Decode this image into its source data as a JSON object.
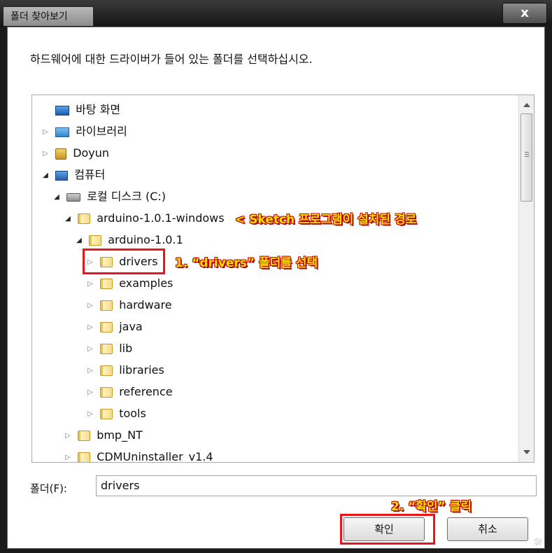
{
  "window": {
    "title": "폴더 찾아보기",
    "close_label": "x"
  },
  "dialog": {
    "instruction": "하드웨어에 대한 드라이버가 들어 있는 폴더를 선택하십시오."
  },
  "tree": {
    "items": [
      {
        "label": "바탕 화면",
        "icon": "desktop-icon"
      },
      {
        "label": "라이브러리",
        "icon": "library-icon"
      },
      {
        "label": "Doyun",
        "icon": "user-folder-icon"
      },
      {
        "label": "컴퓨터",
        "icon": "computer-icon"
      },
      {
        "label": "로컬 디스크 (C:)",
        "icon": "disk-icon"
      },
      {
        "label": "arduino-1.0.1-windows",
        "icon": "folder-icon"
      },
      {
        "label": "arduino-1.0.1",
        "icon": "folder-icon"
      },
      {
        "label": "drivers",
        "icon": "folder-icon"
      },
      {
        "label": "examples",
        "icon": "folder-icon"
      },
      {
        "label": "hardware",
        "icon": "folder-icon"
      },
      {
        "label": "java",
        "icon": "folder-icon"
      },
      {
        "label": "lib",
        "icon": "folder-icon"
      },
      {
        "label": "libraries",
        "icon": "folder-icon"
      },
      {
        "label": "reference",
        "icon": "folder-icon"
      },
      {
        "label": "tools",
        "icon": "folder-icon"
      },
      {
        "label": "bmp_NT",
        "icon": "folder-icon"
      },
      {
        "label": "CDMUninstaller_v1.4",
        "icon": "folder-icon"
      }
    ]
  },
  "annotations": {
    "sketch_path": "< Sketch 프로그램이 설치된 경로",
    "step1": "1. “drivers” 폴더를 선택",
    "step2": "2. “확인” 클릭",
    "highlight_color": "#e8151b",
    "text_color": "#ffdf00"
  },
  "folder_field": {
    "label": "폴더(F):",
    "value": "drivers"
  },
  "buttons": {
    "ok": "확인",
    "cancel": "취소"
  }
}
